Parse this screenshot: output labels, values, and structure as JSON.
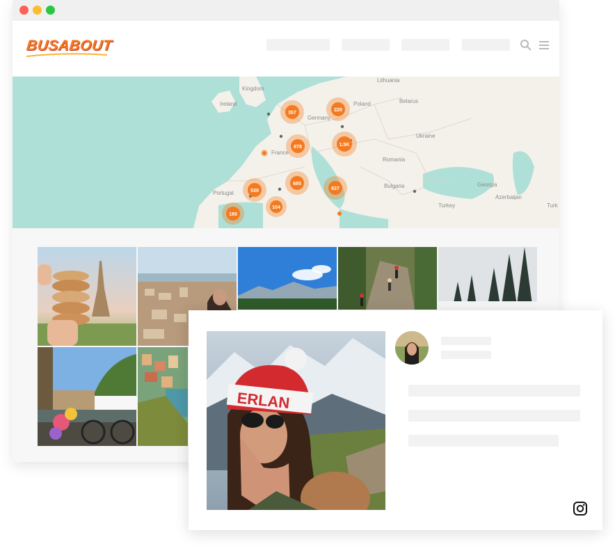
{
  "brand": {
    "logo_text": "BUSABOUT",
    "accent": "#f47a20"
  },
  "window": {
    "controls": [
      "close",
      "minimize",
      "zoom"
    ]
  },
  "header": {
    "icons": [
      "search-icon",
      "menu-icon"
    ]
  },
  "map": {
    "labels": [
      "Lithuania",
      "Kingdom",
      "Poland",
      "Belarus",
      "Ireland",
      "Germany",
      "Ukraine",
      "France",
      "Romania",
      "Portugal",
      "Bulgaria",
      "Georgia",
      "Turkey",
      "Azerbaijan",
      "Turk"
    ],
    "clusters": [
      "357",
      "220",
      "878",
      "1.5K",
      "539",
      "685",
      "637",
      "104",
      "180"
    ],
    "cluster_color": "#f47a20"
  },
  "gallery": {
    "photos": [
      "macarons-eiffel-tower",
      "city-view",
      "mountain-lake",
      "hikers-forest",
      "snowy-forest",
      "amsterdam-canal",
      "cinque-terre"
    ]
  },
  "card": {
    "photo": "woman-in-ski-hat",
    "hat_text": "ERLAN",
    "social_icon": "instagram-icon"
  }
}
